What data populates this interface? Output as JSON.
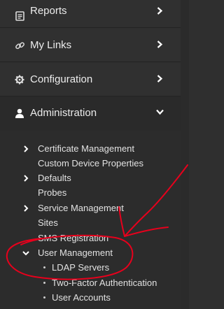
{
  "nav": {
    "items": [
      {
        "label": "Reports",
        "icon": "document-icon",
        "expanded": false
      },
      {
        "label": "My Links",
        "icon": "link-icon",
        "expanded": false
      },
      {
        "label": "Configuration",
        "icon": "gear-icon",
        "expanded": false
      },
      {
        "label": "Administration",
        "icon": "user-icon",
        "expanded": true
      }
    ]
  },
  "administration": {
    "sub_items": [
      {
        "label": "Certificate Management",
        "has_children": true
      },
      {
        "label": "Custom Device Properties",
        "has_children": false
      },
      {
        "label": "Defaults",
        "has_children": true
      },
      {
        "label": "Probes",
        "has_children": false
      },
      {
        "label": "Service Management",
        "has_children": true
      },
      {
        "label": "Sites",
        "has_children": false
      },
      {
        "label": "SMS Registration",
        "has_children": false
      },
      {
        "label": "User Management",
        "has_children": true,
        "expanded": true
      }
    ],
    "user_management_children": [
      {
        "label": "LDAP Servers"
      },
      {
        "label": "Two-Factor Authentication"
      },
      {
        "label": "User Accounts"
      }
    ]
  },
  "colors": {
    "background": "#2f2f2f",
    "text": "#ececec",
    "annotation": "#e8001c"
  }
}
